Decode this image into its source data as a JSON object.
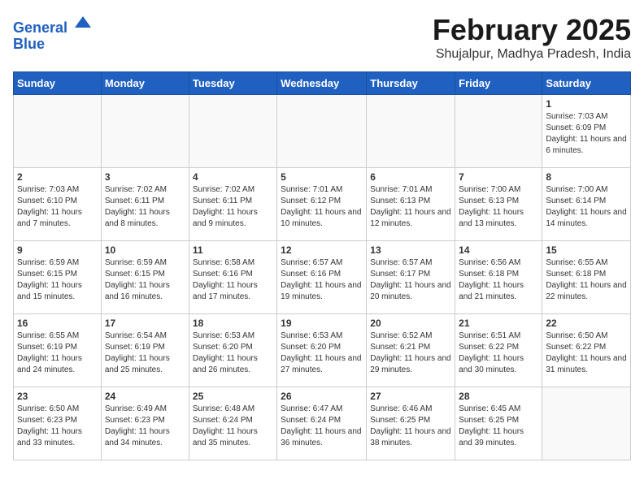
{
  "logo": {
    "line1": "General",
    "line2": "Blue"
  },
  "title": "February 2025",
  "location": "Shujalpur, Madhya Pradesh, India",
  "days_of_week": [
    "Sunday",
    "Monday",
    "Tuesday",
    "Wednesday",
    "Thursday",
    "Friday",
    "Saturday"
  ],
  "weeks": [
    [
      {
        "day": "",
        "info": ""
      },
      {
        "day": "",
        "info": ""
      },
      {
        "day": "",
        "info": ""
      },
      {
        "day": "",
        "info": ""
      },
      {
        "day": "",
        "info": ""
      },
      {
        "day": "",
        "info": ""
      },
      {
        "day": "1",
        "info": "Sunrise: 7:03 AM\nSunset: 6:09 PM\nDaylight: 11 hours and 6 minutes."
      }
    ],
    [
      {
        "day": "2",
        "info": "Sunrise: 7:03 AM\nSunset: 6:10 PM\nDaylight: 11 hours and 7 minutes."
      },
      {
        "day": "3",
        "info": "Sunrise: 7:02 AM\nSunset: 6:11 PM\nDaylight: 11 hours and 8 minutes."
      },
      {
        "day": "4",
        "info": "Sunrise: 7:02 AM\nSunset: 6:11 PM\nDaylight: 11 hours and 9 minutes."
      },
      {
        "day": "5",
        "info": "Sunrise: 7:01 AM\nSunset: 6:12 PM\nDaylight: 11 hours and 10 minutes."
      },
      {
        "day": "6",
        "info": "Sunrise: 7:01 AM\nSunset: 6:13 PM\nDaylight: 11 hours and 12 minutes."
      },
      {
        "day": "7",
        "info": "Sunrise: 7:00 AM\nSunset: 6:13 PM\nDaylight: 11 hours and 13 minutes."
      },
      {
        "day": "8",
        "info": "Sunrise: 7:00 AM\nSunset: 6:14 PM\nDaylight: 11 hours and 14 minutes."
      }
    ],
    [
      {
        "day": "9",
        "info": "Sunrise: 6:59 AM\nSunset: 6:15 PM\nDaylight: 11 hours and 15 minutes."
      },
      {
        "day": "10",
        "info": "Sunrise: 6:59 AM\nSunset: 6:15 PM\nDaylight: 11 hours and 16 minutes."
      },
      {
        "day": "11",
        "info": "Sunrise: 6:58 AM\nSunset: 6:16 PM\nDaylight: 11 hours and 17 minutes."
      },
      {
        "day": "12",
        "info": "Sunrise: 6:57 AM\nSunset: 6:16 PM\nDaylight: 11 hours and 19 minutes."
      },
      {
        "day": "13",
        "info": "Sunrise: 6:57 AM\nSunset: 6:17 PM\nDaylight: 11 hours and 20 minutes."
      },
      {
        "day": "14",
        "info": "Sunrise: 6:56 AM\nSunset: 6:18 PM\nDaylight: 11 hours and 21 minutes."
      },
      {
        "day": "15",
        "info": "Sunrise: 6:55 AM\nSunset: 6:18 PM\nDaylight: 11 hours and 22 minutes."
      }
    ],
    [
      {
        "day": "16",
        "info": "Sunrise: 6:55 AM\nSunset: 6:19 PM\nDaylight: 11 hours and 24 minutes."
      },
      {
        "day": "17",
        "info": "Sunrise: 6:54 AM\nSunset: 6:19 PM\nDaylight: 11 hours and 25 minutes."
      },
      {
        "day": "18",
        "info": "Sunrise: 6:53 AM\nSunset: 6:20 PM\nDaylight: 11 hours and 26 minutes."
      },
      {
        "day": "19",
        "info": "Sunrise: 6:53 AM\nSunset: 6:20 PM\nDaylight: 11 hours and 27 minutes."
      },
      {
        "day": "20",
        "info": "Sunrise: 6:52 AM\nSunset: 6:21 PM\nDaylight: 11 hours and 29 minutes."
      },
      {
        "day": "21",
        "info": "Sunrise: 6:51 AM\nSunset: 6:22 PM\nDaylight: 11 hours and 30 minutes."
      },
      {
        "day": "22",
        "info": "Sunrise: 6:50 AM\nSunset: 6:22 PM\nDaylight: 11 hours and 31 minutes."
      }
    ],
    [
      {
        "day": "23",
        "info": "Sunrise: 6:50 AM\nSunset: 6:23 PM\nDaylight: 11 hours and 33 minutes."
      },
      {
        "day": "24",
        "info": "Sunrise: 6:49 AM\nSunset: 6:23 PM\nDaylight: 11 hours and 34 minutes."
      },
      {
        "day": "25",
        "info": "Sunrise: 6:48 AM\nSunset: 6:24 PM\nDaylight: 11 hours and 35 minutes."
      },
      {
        "day": "26",
        "info": "Sunrise: 6:47 AM\nSunset: 6:24 PM\nDaylight: 11 hours and 36 minutes."
      },
      {
        "day": "27",
        "info": "Sunrise: 6:46 AM\nSunset: 6:25 PM\nDaylight: 11 hours and 38 minutes."
      },
      {
        "day": "28",
        "info": "Sunrise: 6:45 AM\nSunset: 6:25 PM\nDaylight: 11 hours and 39 minutes."
      },
      {
        "day": "",
        "info": ""
      }
    ]
  ]
}
